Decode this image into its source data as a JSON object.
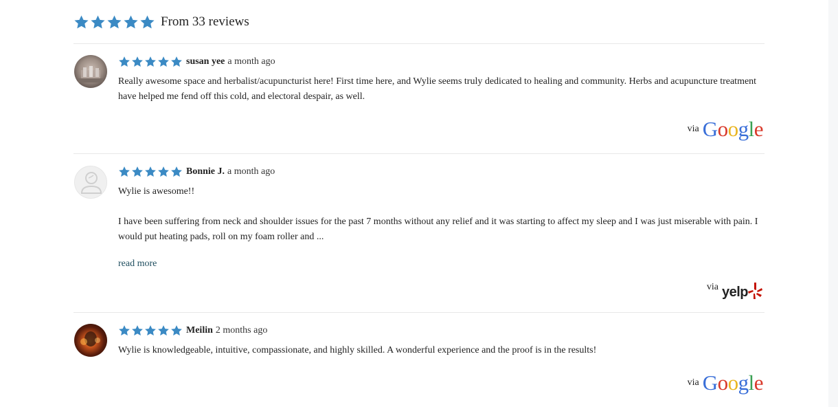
{
  "colors": {
    "star": "#3b8ac4",
    "divider": "#e8e8e8",
    "link": "#1f4e5f"
  },
  "summary": {
    "stars": 5,
    "text": "From 33 reviews"
  },
  "reviews": [
    {
      "author": "susan yee",
      "time": "a month ago",
      "rating": 5,
      "paragraphs": [
        "Really awesome space and herbalist/acupuncturist here! First time here, and Wylie seems truly dedicated to healing and community. Herbs and acupuncture treatment have helped me fend off this cold, and electoral despair, as well."
      ],
      "via_label": "via",
      "source": "Google",
      "source_icon": "google-logo"
    },
    {
      "author": "Bonnie J.",
      "time": "a month ago",
      "rating": 5,
      "paragraphs": [
        "Wylie is awesome!!",
        "I have been suffering from neck and shoulder issues for the past 7 months without any relief and it was starting to affect my sleep and I was just miserable with pain. I would put heating pads, roll on my foam roller and ..."
      ],
      "read_more": "read more",
      "via_label": "via",
      "source": "yelp",
      "source_icon": "yelp-logo"
    },
    {
      "author": "Meilin",
      "time": "2 months ago",
      "rating": 5,
      "paragraphs": [
        "Wylie is knowledgeable, intuitive, compassionate, and highly skilled. A wonderful experience and the proof is in the results!"
      ],
      "via_label": "via",
      "source": "Google",
      "source_icon": "google-logo"
    }
  ]
}
